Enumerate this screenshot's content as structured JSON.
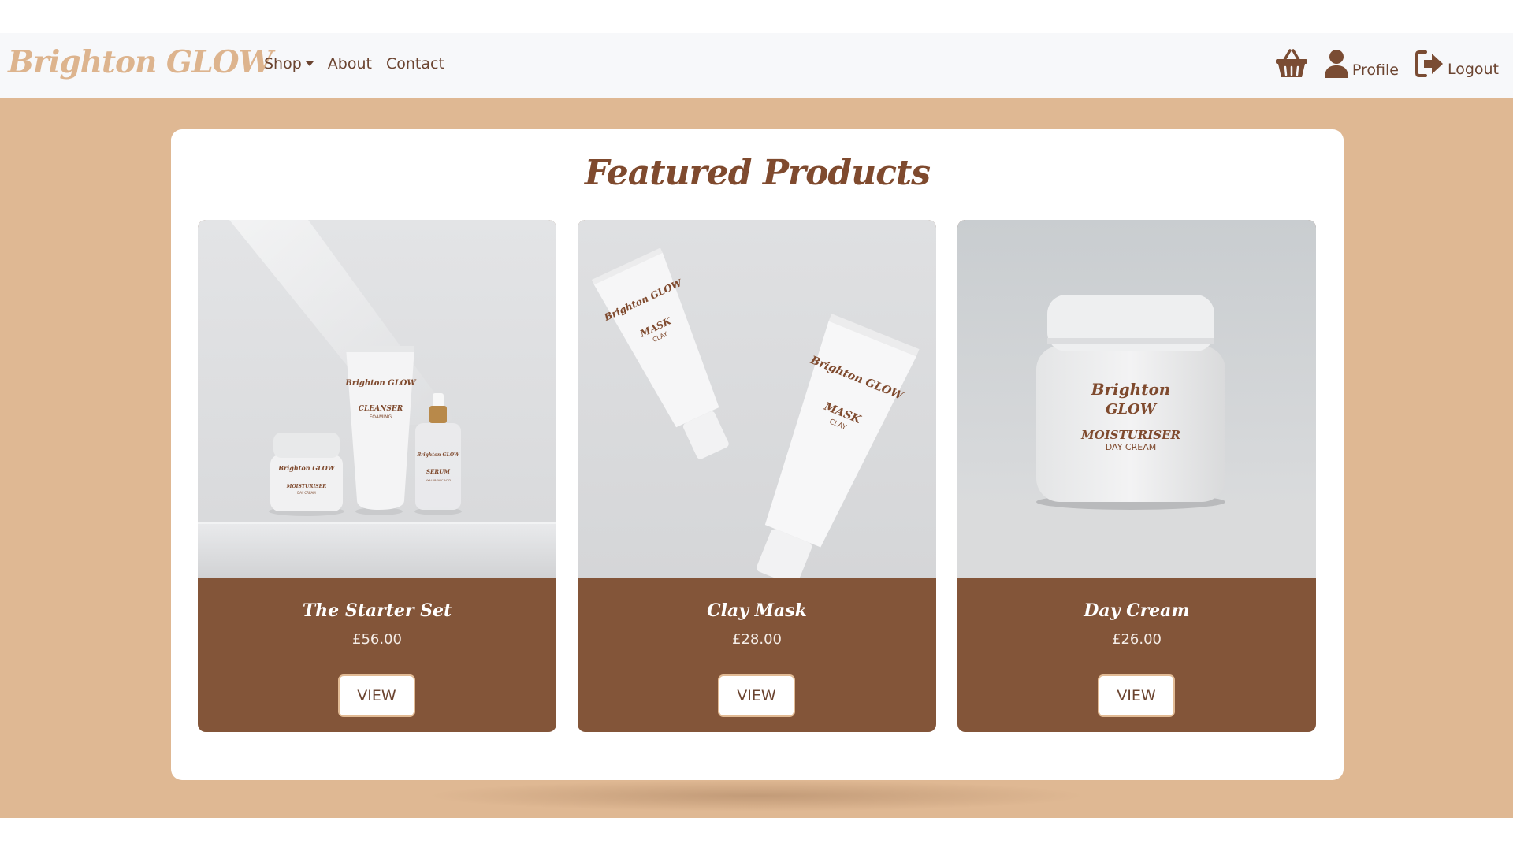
{
  "brand": "Brighton GLOW",
  "nav": {
    "shop": "Shop",
    "about": "About",
    "contact": "Contact",
    "profile": "Profile",
    "logout": "Logout"
  },
  "heading": "Featured Products",
  "products": [
    {
      "name": "The Starter Set",
      "price": "£56.00",
      "button": "VIEW",
      "packaging": {
        "jar_brand": "Brighton GLOW",
        "jar_label": "MOISTURISER",
        "jar_sub": "DAY CREAM",
        "tube_brand": "Brighton GLOW",
        "tube_label": "CLEANSER",
        "tube_sub": "FOAMING",
        "bottle_brand": "Brighton GLOW",
        "bottle_label": "SERUM",
        "bottle_sub": "HYALURONIC ACID"
      }
    },
    {
      "name": "Clay Mask",
      "price": "£28.00",
      "button": "VIEW",
      "packaging": {
        "brand": "Brighton GLOW",
        "label": "MASK",
        "sub": "CLAY"
      }
    },
    {
      "name": "Day Cream",
      "price": "£26.00",
      "button": "VIEW",
      "packaging": {
        "brand_line1": "Brighton",
        "brand_line2": "GLOW",
        "label": "MOISTURISER",
        "sub": "DAY CREAM"
      }
    }
  ],
  "icons": {
    "basket": "basket-icon",
    "profile": "user-icon",
    "logout": "logout-icon",
    "shop_caret": "caret-down-icon"
  },
  "colors": {
    "brand": "#ddb48e",
    "band": "#dfb893",
    "card_footer": "#835539",
    "heading": "#7f4a2e",
    "nav_text": "#6b4430"
  }
}
